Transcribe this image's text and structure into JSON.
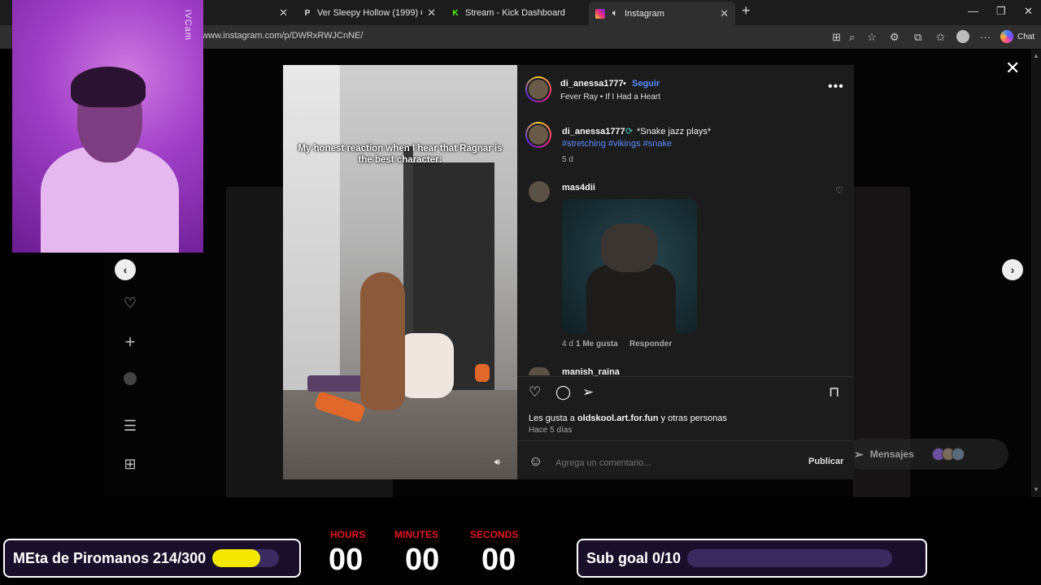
{
  "browser": {
    "tabs": [
      {
        "label": "",
        "icon": "close-icon",
        "active": false
      },
      {
        "label": "Ver Sleepy Hollow (1999) Online G",
        "favicon": "P",
        "active": false
      },
      {
        "label": "Stream - Kick Dashboard",
        "favicon": "K",
        "active": false
      },
      {
        "label": "Instagram",
        "favicon": "instagram",
        "active": true
      }
    ],
    "new_tab_label": "+",
    "url": "www.instagram.com/p/DWRxRWJCnNE/",
    "chat_label": "Chat"
  },
  "webcam": {
    "label": "iVCam"
  },
  "post": {
    "caption_overlay": "My honest reaction when I hear that Ragnar is the best character:",
    "author": "di_anessa1777",
    "follow_label": "Seguir",
    "separator": "•",
    "audio": "Fever Ray • If I Had a Heart",
    "caption_author": "di_anessa1777",
    "caption_text": "*Snake jazz plays*",
    "caption_tags": "#stretching #vikings #snake",
    "caption_age": "5 d",
    "comments": [
      {
        "user": "mas4dii",
        "age": "4 d",
        "likes": "1 Me gusta",
        "reply": "Responder"
      },
      {
        "user": "manish_raina"
      }
    ],
    "likes_prefix": "Les gusta a ",
    "likes_user": "oldskool.art.for.fun",
    "likes_suffix": " y otras personas",
    "posted": "Hace 5 días",
    "comment_placeholder": "Agrega un comentario...",
    "publish_label": "Publicar"
  },
  "page": {
    "messages_label": "Mensajes"
  },
  "overlay": {
    "goal_left": "MEta de Piromanos 214/300",
    "goal_left_progress": 0.713,
    "goal_right": "Sub goal 0/10",
    "goal_right_progress": 0.0,
    "accent": "#f5e800",
    "timer": {
      "hours_label": "HOURS",
      "minutes_label": "MINUTES",
      "seconds_label": "SECONDS",
      "hours": "00",
      "minutes": "00",
      "seconds": "00"
    }
  }
}
